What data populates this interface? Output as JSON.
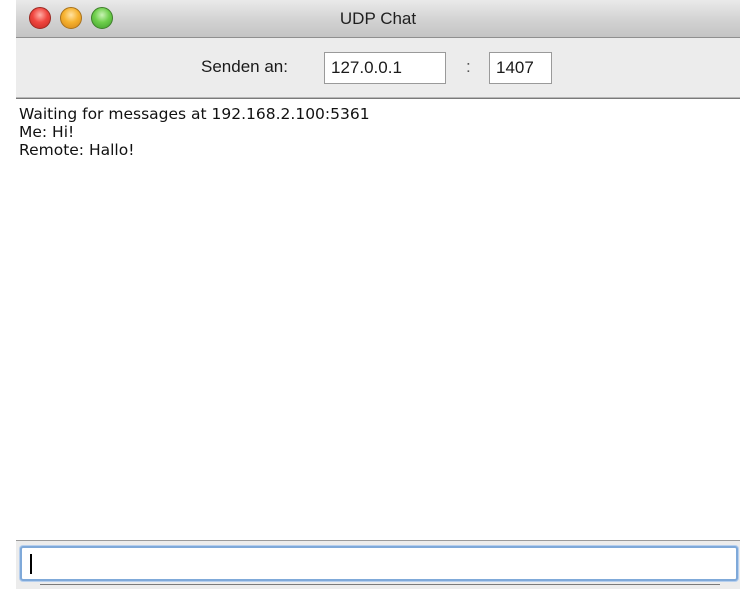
{
  "window": {
    "title": "UDP Chat"
  },
  "send_bar": {
    "label": "Senden an:",
    "ip_value": "127.0.0.1",
    "separator": ":",
    "port_value": "1407"
  },
  "log": {
    "lines": [
      "Waiting for messages at 192.168.2.100:5361",
      "Me: Hi!",
      "Remote: Hallo!"
    ]
  },
  "message_input": {
    "value": ""
  },
  "colors": {
    "close": "#f0463f",
    "minimize": "#f6b22f",
    "zoom": "#6fcf4c",
    "focus_ring": "#7fa9d9"
  }
}
